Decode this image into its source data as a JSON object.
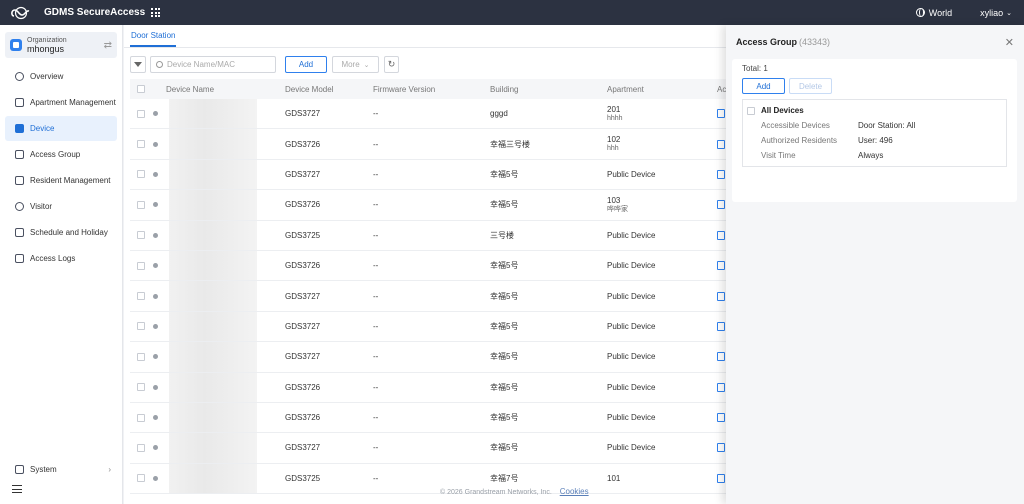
{
  "app": {
    "title": "GDMS SecureAccess"
  },
  "topbar": {
    "region": "World",
    "user": "xyliao"
  },
  "org": {
    "label": "Organization",
    "name": "mhongus"
  },
  "nav": [
    {
      "label": "Overview",
      "icon": "overview-icon"
    },
    {
      "label": "Apartment Management",
      "icon": "apartment-icon"
    },
    {
      "label": "Device",
      "icon": "device-icon",
      "active": true
    },
    {
      "label": "Access Group",
      "icon": "access-group-icon"
    },
    {
      "label": "Resident Management",
      "icon": "resident-icon"
    },
    {
      "label": "Visitor",
      "icon": "visitor-icon"
    },
    {
      "label": "Schedule and Holiday",
      "icon": "calendar-icon"
    },
    {
      "label": "Access Logs",
      "icon": "logs-icon"
    }
  ],
  "system": {
    "label": "System"
  },
  "tab": {
    "label": "Door Station"
  },
  "toolbar": {
    "search_placeholder": "Device Name/MAC",
    "add_label": "Add",
    "more_label": "More"
  },
  "columns": [
    "Device Name",
    "Device Model",
    "Firmware Version",
    "Building",
    "Apartment",
    "Ac"
  ],
  "rows": [
    {
      "model": "GDS3727",
      "fw": "--",
      "building": "gggd",
      "apt": "201",
      "apt_sub": "hhhh"
    },
    {
      "model": "GDS3726",
      "fw": "--",
      "building": "幸福三号楼",
      "apt": "102",
      "apt_sub": "hhh"
    },
    {
      "model": "GDS3727",
      "fw": "--",
      "building": "幸福5号",
      "apt": "Public Device",
      "apt_sub": ""
    },
    {
      "model": "GDS3726",
      "fw": "--",
      "building": "幸福5号",
      "apt": "103",
      "apt_sub": "哗哗家"
    },
    {
      "model": "GDS3725",
      "fw": "--",
      "building": "三号楼",
      "apt": "Public Device",
      "apt_sub": ""
    },
    {
      "model": "GDS3726",
      "fw": "--",
      "building": "幸福5号",
      "apt": "Public Device",
      "apt_sub": ""
    },
    {
      "model": "GDS3727",
      "fw": "--",
      "building": "幸福5号",
      "apt": "Public Device",
      "apt_sub": ""
    },
    {
      "model": "GDS3727",
      "fw": "--",
      "building": "幸福5号",
      "apt": "Public Device",
      "apt_sub": ""
    },
    {
      "model": "GDS3727",
      "fw": "--",
      "building": "幸福5号",
      "apt": "Public Device",
      "apt_sub": ""
    },
    {
      "model": "GDS3726",
      "fw": "--",
      "building": "幸福5号",
      "apt": "Public Device",
      "apt_sub": ""
    },
    {
      "model": "GDS3726",
      "fw": "--",
      "building": "幸福5号",
      "apt": "Public Device",
      "apt_sub": ""
    },
    {
      "model": "GDS3727",
      "fw": "--",
      "building": "幸福5号",
      "apt": "Public Device",
      "apt_sub": ""
    },
    {
      "model": "GDS3725",
      "fw": "--",
      "building": "幸福7号",
      "apt": "101",
      "apt_sub": ""
    }
  ],
  "footer": {
    "copyright": "© 2026 Grandstream Networks, Inc.",
    "cookies": "Cookies"
  },
  "panel": {
    "title": "Access Group",
    "count": "(43343)",
    "total": "Total: 1",
    "add_label": "Add",
    "delete_label": "Delete",
    "group_name": "All Devices",
    "fields": [
      {
        "label": "Accessible Devices",
        "value": "Door Station: All"
      },
      {
        "label": "Authorized Residents",
        "value": "User: 496"
      },
      {
        "label": "Visit Time",
        "value": "Always"
      }
    ]
  },
  "colors": {
    "topbar": "#2c3241",
    "accent": "#1f6fd6"
  }
}
